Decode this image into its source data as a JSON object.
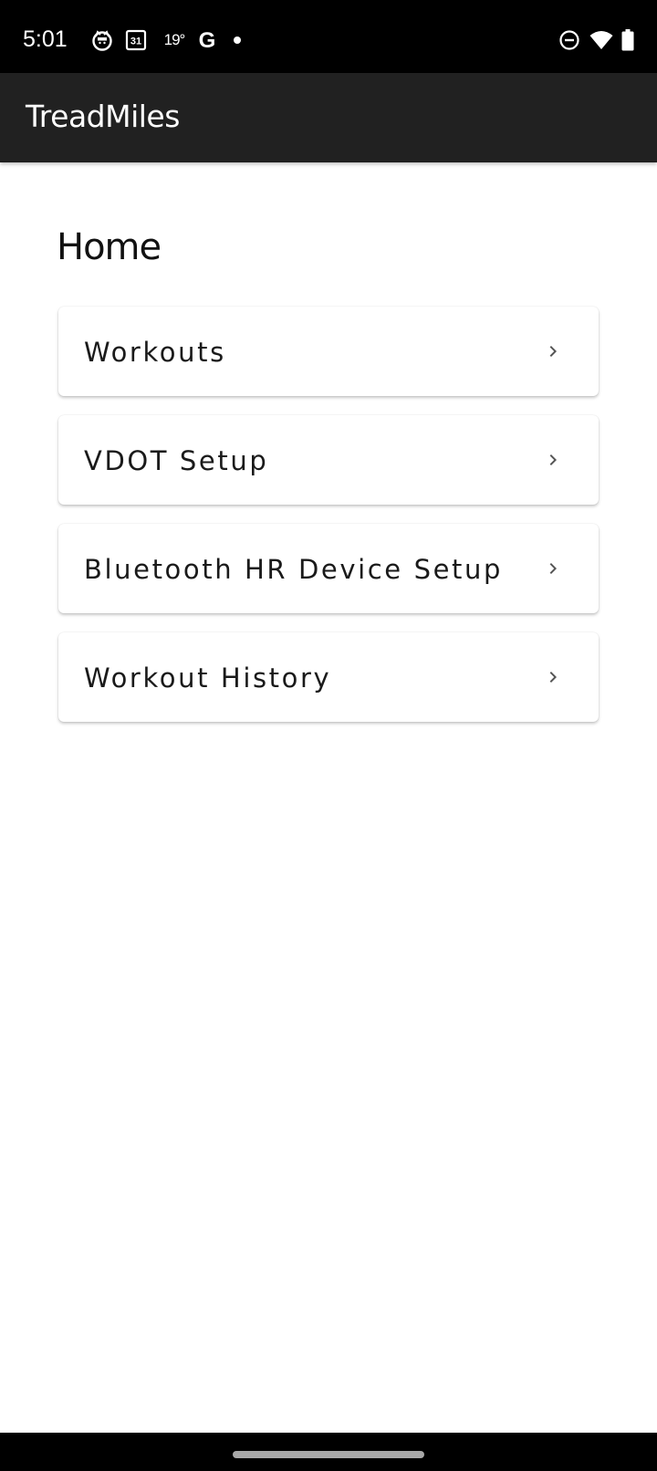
{
  "status_bar": {
    "time": "5:01",
    "calendar_day": "31",
    "temperature": "19°",
    "google_letter": "G",
    "icons": [
      "cat-face-icon",
      "calendar-icon",
      "google-icon",
      "notification-dot-icon",
      "do-not-disturb-icon",
      "wifi-icon",
      "battery-icon"
    ]
  },
  "app_bar": {
    "title": "TreadMiles"
  },
  "page": {
    "title": "Home",
    "menu_items": [
      {
        "label": "Workouts"
      },
      {
        "label": "VDOT Setup"
      },
      {
        "label": "Bluetooth HR Device Setup"
      },
      {
        "label": "Workout History"
      }
    ]
  },
  "colors": {
    "status_bar_bg": "#000000",
    "app_bar_bg": "#212121",
    "page_bg": "#ffffff",
    "chevron": "#555555"
  }
}
